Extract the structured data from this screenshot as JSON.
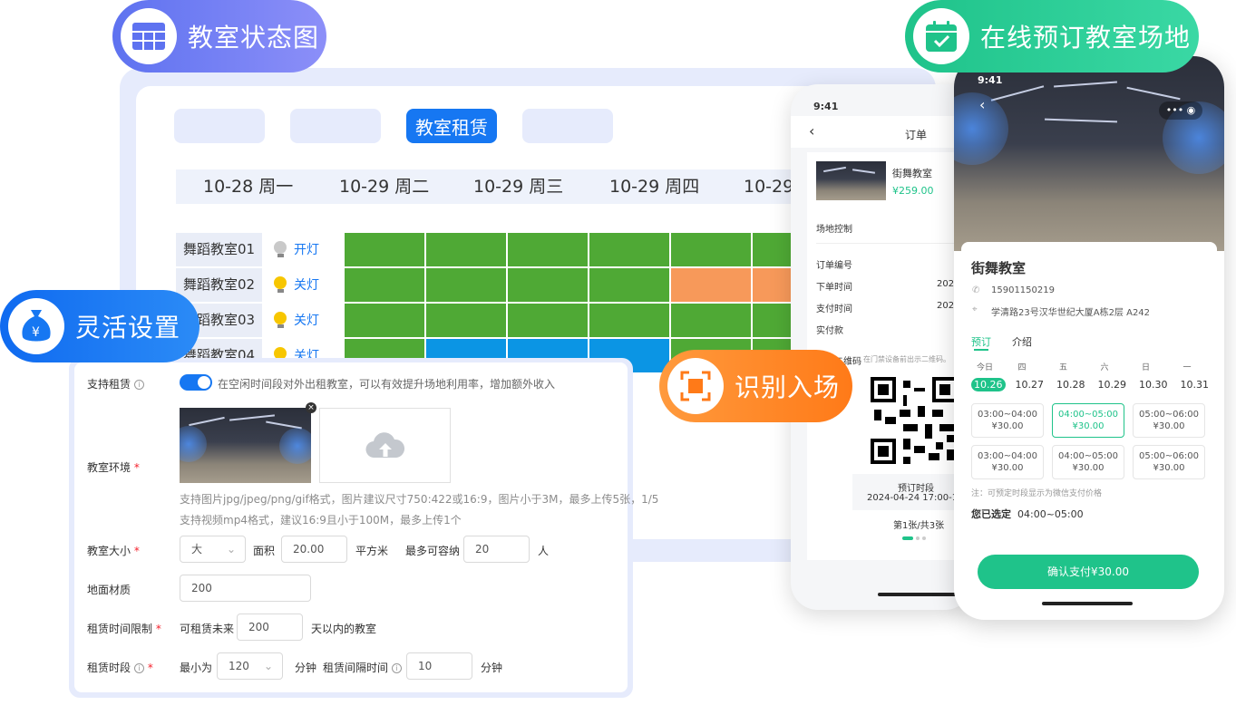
{
  "pills": {
    "status_map": "教室状态图",
    "flexible": "灵活设置",
    "scan_entry": "识别入场",
    "online_booking": "在线预订教室场地"
  },
  "colors": {
    "green_cell": "#4fa935",
    "orange_cell": "#f7995a",
    "blue_cell": "#0b95e4",
    "brand_blue": "#1677f2",
    "brand_green": "#1fc38a"
  },
  "schedule": {
    "tabs": [
      "",
      "",
      "教室租赁",
      ""
    ],
    "active_tab": 2,
    "dates": [
      "10-28 周一",
      "10-29 周二",
      "10-29 周三",
      "10-29 周四",
      "10-29"
    ],
    "rooms": [
      {
        "name": "舞蹈教室01",
        "light": "开灯",
        "bulb": "off",
        "cells": [
          "green",
          "green",
          "green",
          "green",
          "green",
          "green"
        ]
      },
      {
        "name": "舞蹈教室02",
        "light": "关灯",
        "bulb": "on",
        "cells": [
          "green",
          "green",
          "green",
          "green",
          "orange",
          "orange"
        ]
      },
      {
        "name": "舞蹈教室03",
        "light": "关灯",
        "bulb": "on",
        "cells": [
          "green",
          "green",
          "green",
          "green",
          "green",
          "green"
        ]
      },
      {
        "name": "舞蹈教室04",
        "light": "关灯",
        "bulb": "on",
        "cells": [
          "green",
          "blue",
          "blue",
          "blue",
          "green",
          "green"
        ]
      }
    ]
  },
  "settings": {
    "support_rent_label": "支持租赁",
    "support_rent_hint": "在空闲时间段对外出租教室，可以有效提升场地利用率，增加额外收入",
    "env_label": "教室环境",
    "upload_hint1": "支持图片jpg/jpeg/png/gif格式，图片建议尺寸750:422或16:9，图片小于3M，最多上传5张，1/5",
    "upload_hint2": "支持视频mp4格式，建议16:9且小于100M，最多上传1个",
    "size_label": "教室大小",
    "size_value": "大",
    "area_label": "面积",
    "area_value": "20.00",
    "area_unit": "平方米",
    "capacity_label": "最多可容纳",
    "capacity_value": "20",
    "capacity_unit": "人",
    "floor_label": "地面材质",
    "floor_value": "200",
    "rent_limit_label": "租赁时间限制",
    "rent_limit_prefix": "可租赁未来",
    "rent_limit_value": "200",
    "rent_limit_suffix": "天以内的教室",
    "rent_period_label": "租赁时段",
    "min_label": "最小为",
    "min_value": "120",
    "min_unit": "分钟",
    "interval_label": "租赁间隔时间",
    "interval_value": "10",
    "interval_unit": "分钟"
  },
  "order_phone": {
    "time": "9:41",
    "title": "订单",
    "venue": "街舞教室",
    "price": "¥259.00",
    "venue_control": "场地控制",
    "order_no": "订单编号",
    "order_time": "下单时间",
    "order_time_value": "202",
    "pay_time": "支付时间",
    "pay_time_value": "202",
    "paid": "实付款",
    "qr_title": "二维码",
    "qr_note": "在门禁设备前出示二维码。",
    "booked_period": "预订时段",
    "booked_period_value": "2024-04-24 17:00-18:",
    "page_indicator": "第1张/共3张"
  },
  "booking_phone": {
    "time": "9:41",
    "venue": "街舞教室",
    "phone": "15901150219",
    "address": "学清路23号汉华世纪大厦A栋2层 A242",
    "tab_book": "预订",
    "tab_intro": "介绍",
    "days": [
      {
        "week": "今日",
        "date": "10.26"
      },
      {
        "week": "四",
        "date": "10.27"
      },
      {
        "week": "五",
        "date": "10.28"
      },
      {
        "week": "六",
        "date": "10.29"
      },
      {
        "week": "日",
        "date": "10.30"
      },
      {
        "week": "一",
        "date": "10.31"
      }
    ],
    "slots": [
      {
        "time": "03:00~04:00",
        "price": "¥30.00"
      },
      {
        "time": "04:00~05:00",
        "price": "¥30.00"
      },
      {
        "time": "05:00~06:00",
        "price": "¥30.00"
      },
      {
        "time": "03:00~04:00",
        "price": "¥30.00"
      },
      {
        "time": "04:00~05:00",
        "price": "¥30.00"
      },
      {
        "time": "05:00~06:00",
        "price": "¥30.00"
      }
    ],
    "note": "注：可预定时段显示为微信支付价格",
    "selected_label": "您已选定",
    "selected_value": "04:00~05:00",
    "confirm": "确认支付¥30.00"
  }
}
